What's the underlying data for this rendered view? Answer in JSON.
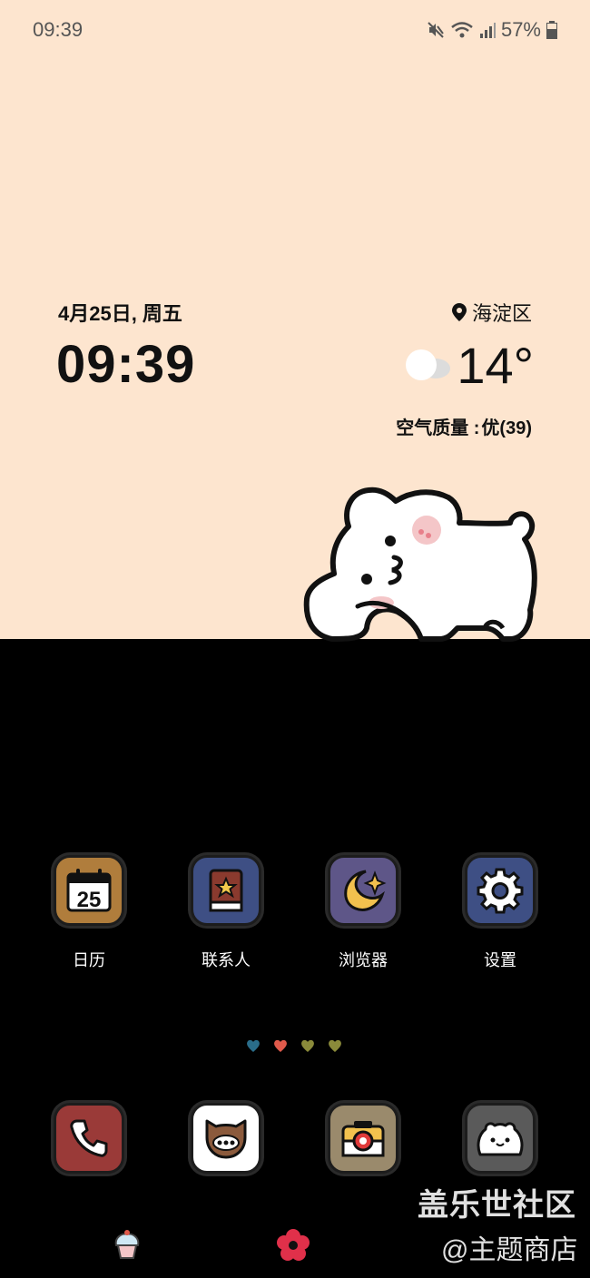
{
  "status_bar": {
    "time": "09:39",
    "battery": "57%"
  },
  "widget": {
    "date": "4月25日, 周五",
    "time": "09:39",
    "location": "海淀区",
    "temperature": "14°",
    "aqi_label": "空气质量 :",
    "aqi_value": "优(39)"
  },
  "apps": [
    {
      "label": "日历",
      "icon": "calendar-icon",
      "day": "25",
      "color": "#b07d3c"
    },
    {
      "label": "联系人",
      "icon": "contacts-book-icon",
      "color": "#3e4f84"
    },
    {
      "label": "浏览器",
      "icon": "moon-icon",
      "color": "#5e5688"
    },
    {
      "label": "设置",
      "icon": "gear-icon",
      "color": "#3e4f84"
    }
  ],
  "page_indicator": {
    "count": 4,
    "active_index": 1,
    "colors": [
      "#2a6d8a",
      "#e05a4b",
      "#8a8a3a",
      "#8a8a3a"
    ]
  },
  "dock": [
    {
      "icon": "phone-icon",
      "color": "#9a3a38"
    },
    {
      "icon": "chat-cat-icon",
      "color": "#ffffff"
    },
    {
      "icon": "camera-icon",
      "color": "#9a8a6c"
    },
    {
      "icon": "gallery-bear-icon",
      "color": "#5a5a5a"
    }
  ],
  "bottom_icons": [
    "cupcake-icon",
    "flower-icon"
  ],
  "watermark": {
    "line1": "盖乐世社区",
    "line2": "@主题商店"
  }
}
